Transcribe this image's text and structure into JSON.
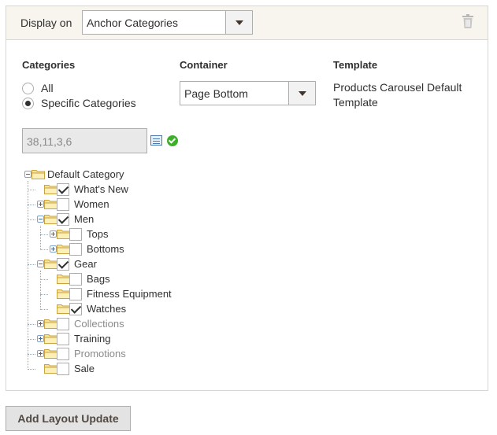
{
  "header": {
    "display_on_label": "Display on",
    "display_on_value": "Anchor Categories",
    "delete_icon": "trash-icon"
  },
  "categories_section": {
    "title": "Categories",
    "options": [
      {
        "label": "All",
        "checked": false
      },
      {
        "label": "Specific Categories",
        "checked": true
      }
    ],
    "ids_value": "38,11,3,6",
    "chooser_icon": "list-icon",
    "apply_icon": "checkmark-icon"
  },
  "container_section": {
    "title": "Container",
    "value": "Page Bottom"
  },
  "template_section": {
    "title": "Template",
    "value": "Products Carousel Default Template"
  },
  "tree": [
    {
      "label": "Default Category",
      "level": 0,
      "toggle": "minus",
      "checkbox": null,
      "muted": false
    },
    {
      "label": "What's New",
      "level": 1,
      "toggle": null,
      "checkbox": true,
      "muted": false
    },
    {
      "label": "Women",
      "level": 1,
      "toggle": "plus",
      "checkbox": false,
      "muted": false
    },
    {
      "label": "Men",
      "level": 1,
      "toggle": "minus",
      "checkbox": true,
      "muted": false
    },
    {
      "label": "Tops",
      "level": 2,
      "toggle": "plus",
      "checkbox": false,
      "muted": false
    },
    {
      "label": "Bottoms",
      "level": 2,
      "toggle": "plus",
      "checkbox": false,
      "muted": false
    },
    {
      "label": "Gear",
      "level": 1,
      "toggle": "minus",
      "checkbox": true,
      "muted": false
    },
    {
      "label": "Bags",
      "level": 2,
      "toggle": null,
      "checkbox": false,
      "muted": false
    },
    {
      "label": "Fitness Equipment",
      "level": 2,
      "toggle": null,
      "checkbox": false,
      "muted": false
    },
    {
      "label": "Watches",
      "level": 2,
      "toggle": null,
      "checkbox": true,
      "muted": false
    },
    {
      "label": "Collections",
      "level": 1,
      "toggle": "plus",
      "checkbox": false,
      "muted": true
    },
    {
      "label": "Training",
      "level": 1,
      "toggle": "plus",
      "checkbox": false,
      "muted": false
    },
    {
      "label": "Promotions",
      "level": 1,
      "toggle": "plus",
      "checkbox": false,
      "muted": true
    },
    {
      "label": "Sale",
      "level": 1,
      "toggle": null,
      "checkbox": false,
      "muted": false
    }
  ],
  "footer": {
    "add_button_label": "Add Layout Update"
  }
}
